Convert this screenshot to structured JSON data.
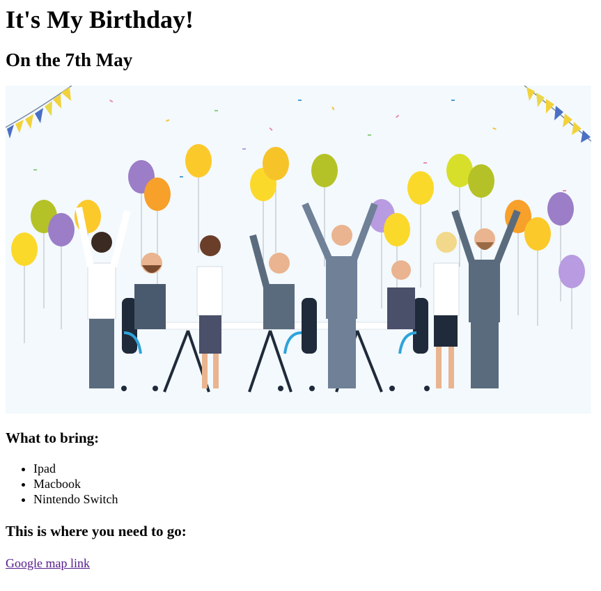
{
  "header": {
    "title": "It's My Birthday!",
    "subtitle": "On the 7th May"
  },
  "bring": {
    "heading": "What to bring:",
    "items": [
      "Ipad",
      "Macbook",
      "Nintendo Switch"
    ]
  },
  "directions": {
    "heading": "This is where you need to go:",
    "link_text": "Google map link"
  },
  "colors": {
    "link": "#551a8b",
    "illustration_bg": "#f3f9fd"
  }
}
